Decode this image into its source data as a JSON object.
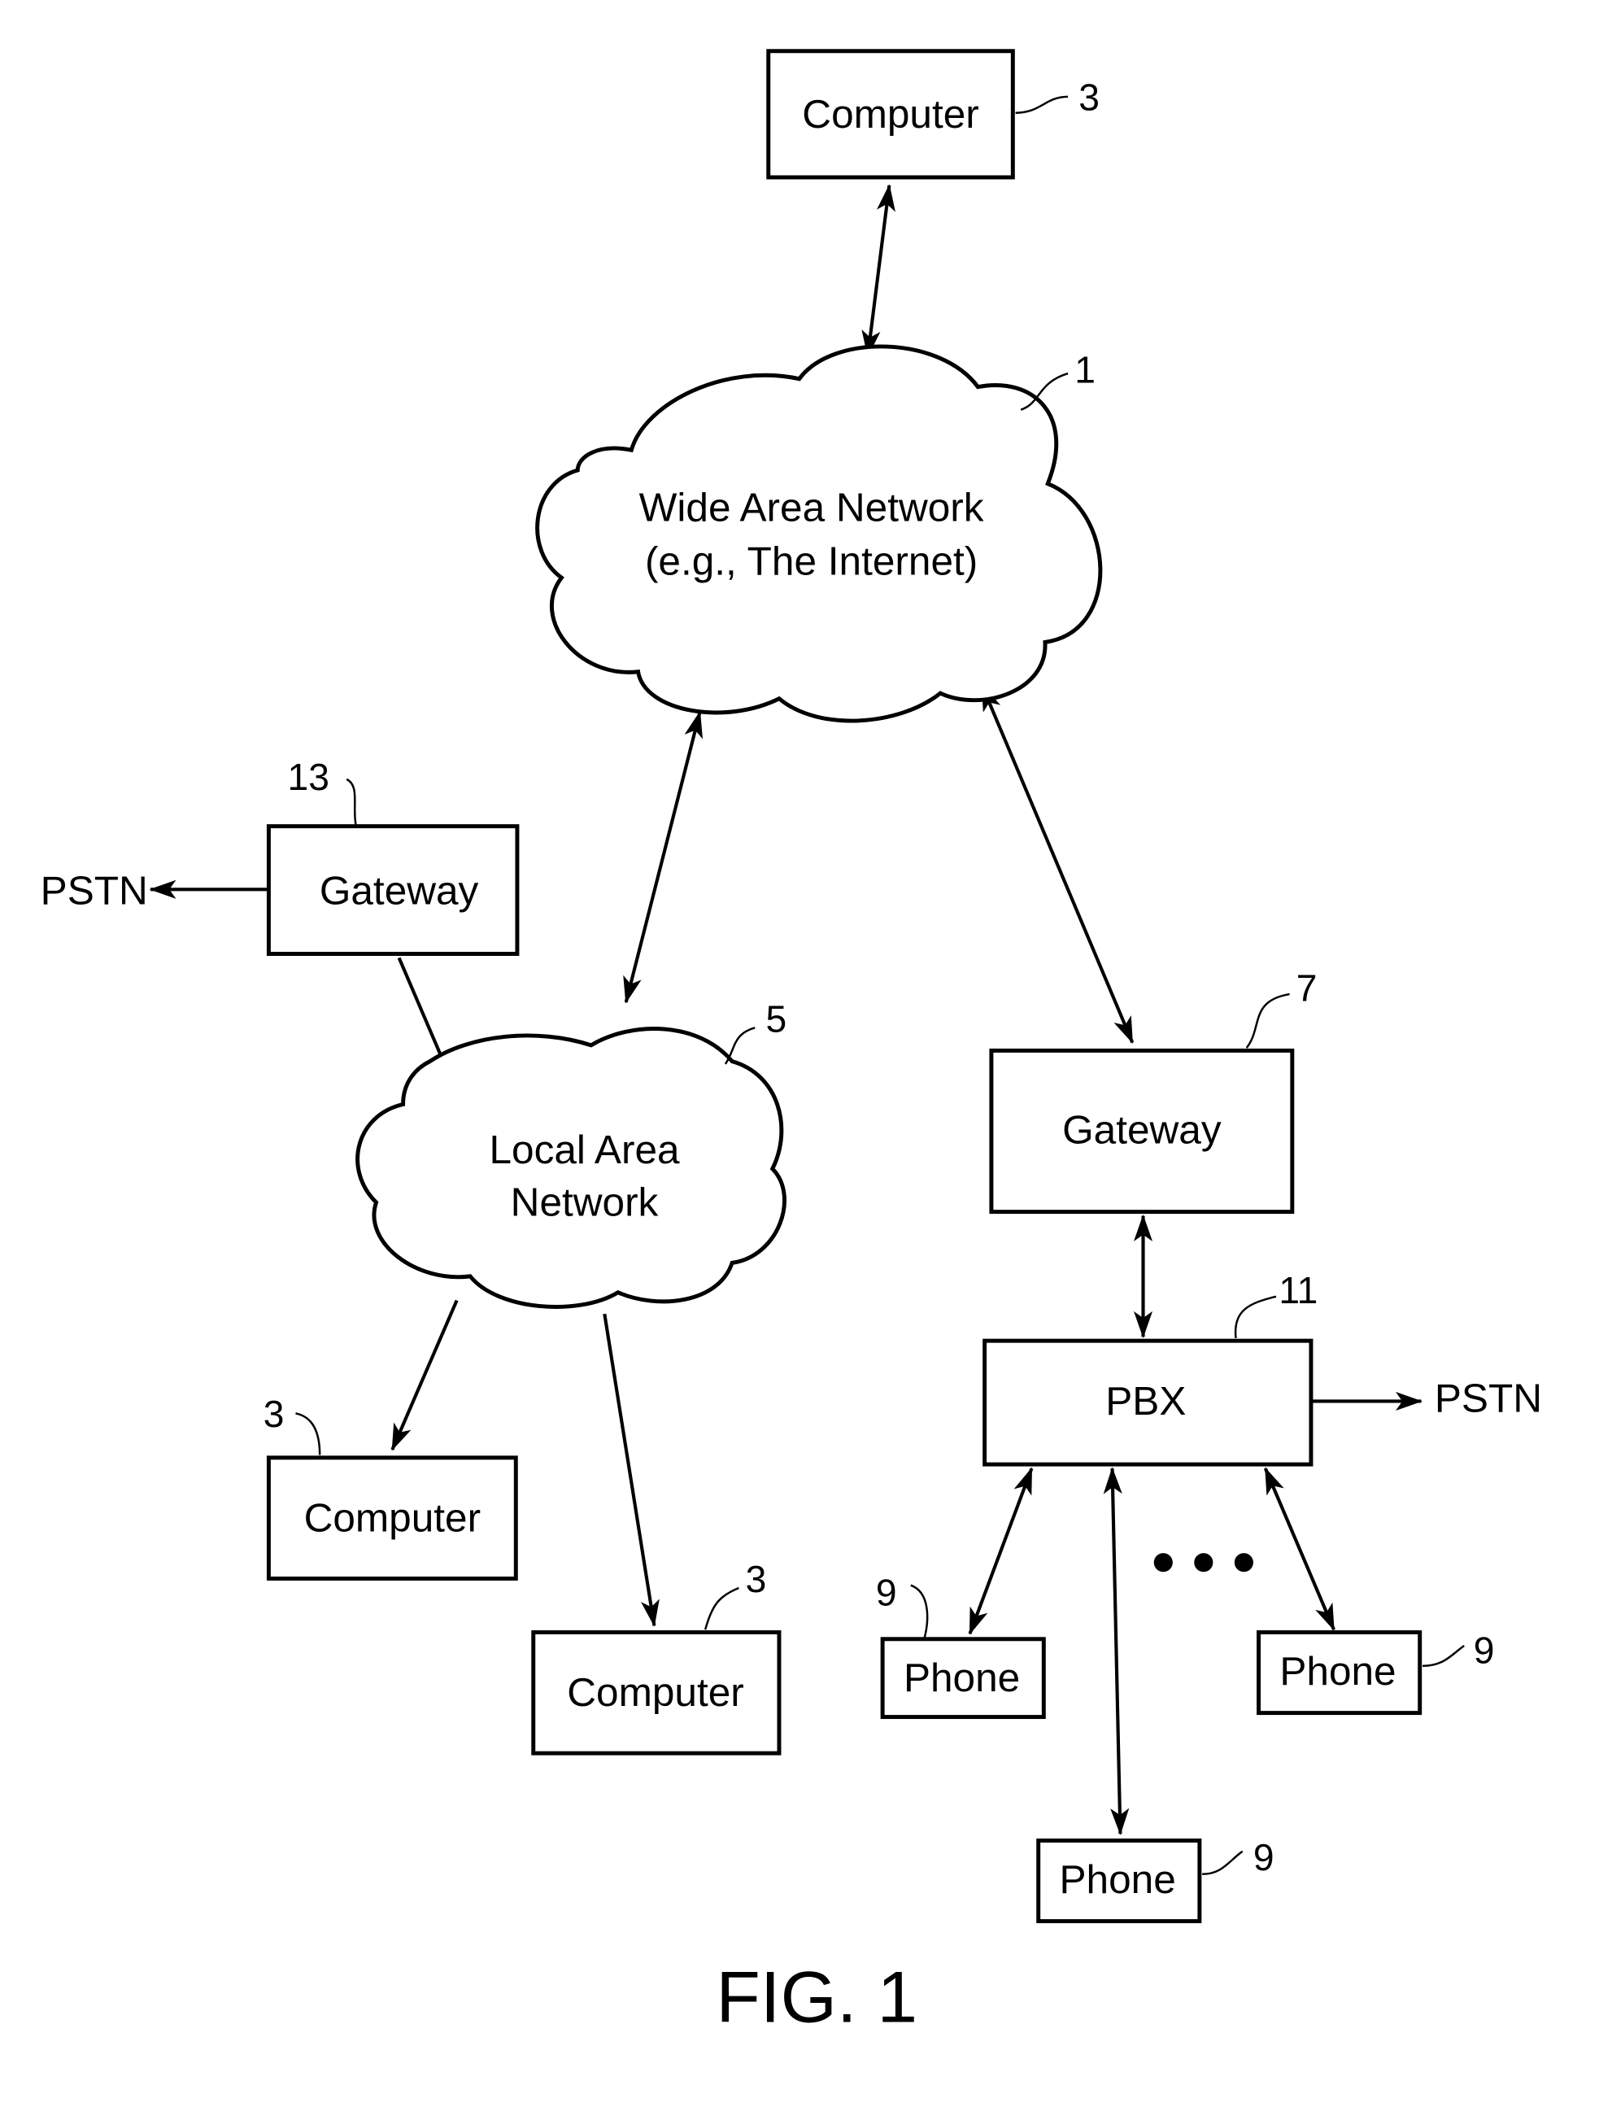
{
  "figure": {
    "caption": "FIG. 1",
    "nodes": {
      "computer_top": {
        "label": "Computer",
        "ref": "3"
      },
      "wan": {
        "line1": "Wide Area Network",
        "line2": "(e.g., The Internet)",
        "ref": "1"
      },
      "gateway_left": {
        "label": "Gateway",
        "ref": "13"
      },
      "lan": {
        "line1": "Local Area",
        "line2": "Network",
        "ref": "5"
      },
      "gateway_right": {
        "label": "Gateway",
        "ref": "7"
      },
      "pbx": {
        "label": "PBX",
        "ref": "11"
      },
      "computer_left": {
        "label": "Computer",
        "ref": "3"
      },
      "computer_bottom": {
        "label": "Computer",
        "ref": "3"
      },
      "phone_left": {
        "label": "Phone",
        "ref": "9"
      },
      "phone_right": {
        "label": "Phone",
        "ref": "9"
      },
      "phone_bottom": {
        "label": "Phone",
        "ref": "9"
      }
    },
    "external": {
      "pstn_left": "PSTN",
      "pstn_right": "PSTN"
    },
    "ellipsis": "• • •"
  }
}
